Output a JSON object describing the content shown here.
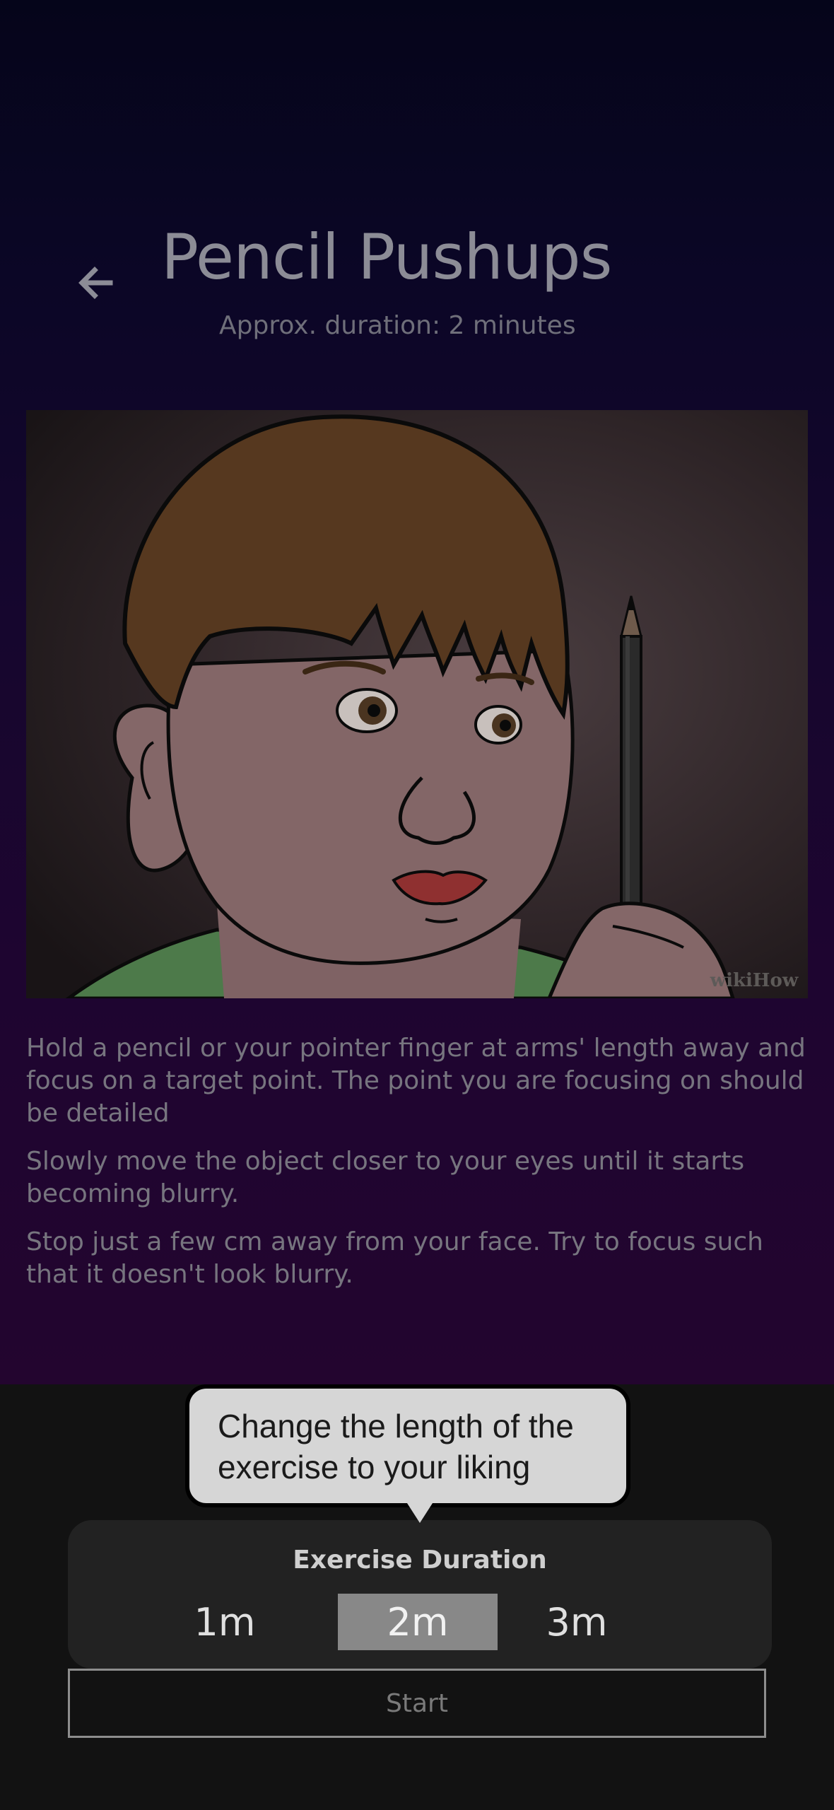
{
  "header": {
    "title": "Pencil Pushups",
    "subtitle": "Approx. duration: 2 minutes",
    "back_icon": "arrow-left-icon"
  },
  "illustration": {
    "watermark": "wikiHow"
  },
  "instructions": [
    "Hold a pencil or your pointer finger at arms' length away and focus on a target point. The point you are focusing on should be detailed",
    "Slowly move the object closer to your eyes until it starts becoming blurry.",
    "Stop just a few cm away from your face. Try to focus such that it doesn't look blurry."
  ],
  "tooltip": {
    "text": "Change the length of the exercise to your liking"
  },
  "duration": {
    "label": "Exercise Duration",
    "options": [
      "1m",
      "2m",
      "3m"
    ],
    "selected": "2m"
  },
  "start_button": {
    "label": "Start"
  },
  "colors": {
    "background_top": "#05051a",
    "background_bottom": "#23052f",
    "panel": "#222222",
    "selected_option": "#888888",
    "tooltip_bg": "#d6d6d6"
  }
}
